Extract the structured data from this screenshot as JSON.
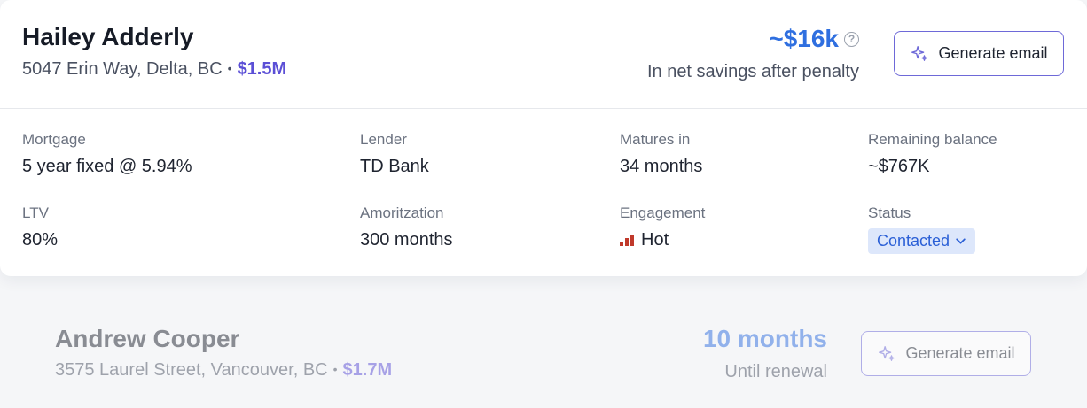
{
  "card1": {
    "name": "Hailey Adderly",
    "address": "5047 Erin Way, Delta, BC",
    "separator": "•",
    "price": "$1.5M",
    "savings_amount": "~$16k",
    "savings_label": "In net savings after penalty",
    "help_glyph": "?",
    "generate_label": "Generate email",
    "fields": {
      "mortgage": {
        "label": "Mortgage",
        "value": "5 year fixed @ 5.94%"
      },
      "lender": {
        "label": "Lender",
        "value": "TD Bank"
      },
      "matures": {
        "label": "Matures in",
        "value": "34 months"
      },
      "balance": {
        "label": "Remaining balance",
        "value": "~$767K"
      },
      "ltv": {
        "label": "LTV",
        "value": "80%"
      },
      "amortization": {
        "label": "Amoritzation",
        "value": "300 months"
      },
      "engagement": {
        "label": "Engagement",
        "value": "Hot",
        "icon": "signal-bars-icon"
      },
      "status": {
        "label": "Status",
        "value": "Contacted"
      }
    }
  },
  "card2": {
    "name": "Andrew Cooper",
    "address": "3575 Laurel Street, Vancouver, BC",
    "separator": "•",
    "price": "$1.7M",
    "renewal_amount": "10 months",
    "renewal_label": "Until renewal",
    "generate_label": "Generate email"
  },
  "colors": {
    "accent_blue": "#2f6fe0",
    "price_purple": "#5b4fd6",
    "hot_red": "#c0392b",
    "status_bg": "#dde7fb"
  }
}
